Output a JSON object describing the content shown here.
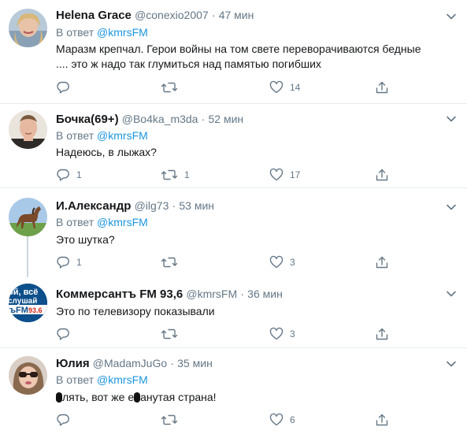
{
  "reply_prefix": "В ответ",
  "tweets": [
    {
      "name": "Helena Grace",
      "handle": "@conexio2007",
      "sep": "·",
      "time": "47 мин",
      "reply_to": "@kmrsFM",
      "text_line1": "Маразм крепчал. Герои войны на том свете переворачиваются бедные",
      "text_line2": ".... это ж надо так глумиться над памятью погибших",
      "replies": "",
      "retweets": "",
      "likes": "14"
    },
    {
      "name": "Бочка(69+)",
      "handle": "@Bo4ka_m3da",
      "sep": "·",
      "time": "52 мин",
      "reply_to": "@kmrsFM",
      "text": "Надеюсь, в лыжах?",
      "replies": "1",
      "retweets": "1",
      "likes": "17"
    },
    {
      "name": "И.Александр",
      "handle": "@ilg73",
      "sep": "·",
      "time": "53 мин",
      "reply_to": "@kmrsFM",
      "text": "Это шутка?",
      "replies": "1",
      "retweets": "",
      "likes": "3"
    },
    {
      "name": "Коммерсантъ FM 93,6",
      "handle": "@kmrsFM",
      "sep": "·",
      "time": "36 мин",
      "text": "Это по телевизору показывали",
      "avatar_text_1": "ой, всё",
      "avatar_text_2": "слушай",
      "avatar_text_3": "ъFM",
      "avatar_text_4": "93.6",
      "replies": "",
      "retweets": "",
      "likes": "3"
    },
    {
      "name": "Юлия",
      "handle": "@MadamJuGo",
      "sep": "·",
      "time": "35 мин",
      "reply_to": "@kmrsFM",
      "text_part1": "лять, вот же е",
      "text_part2": "анутая страна!",
      "replies": "",
      "retweets": "",
      "likes": "6"
    }
  ],
  "colors": {
    "link": "#1b95e0",
    "muted": "#657786",
    "divider": "#e6ecf0",
    "text": "#14171a"
  }
}
